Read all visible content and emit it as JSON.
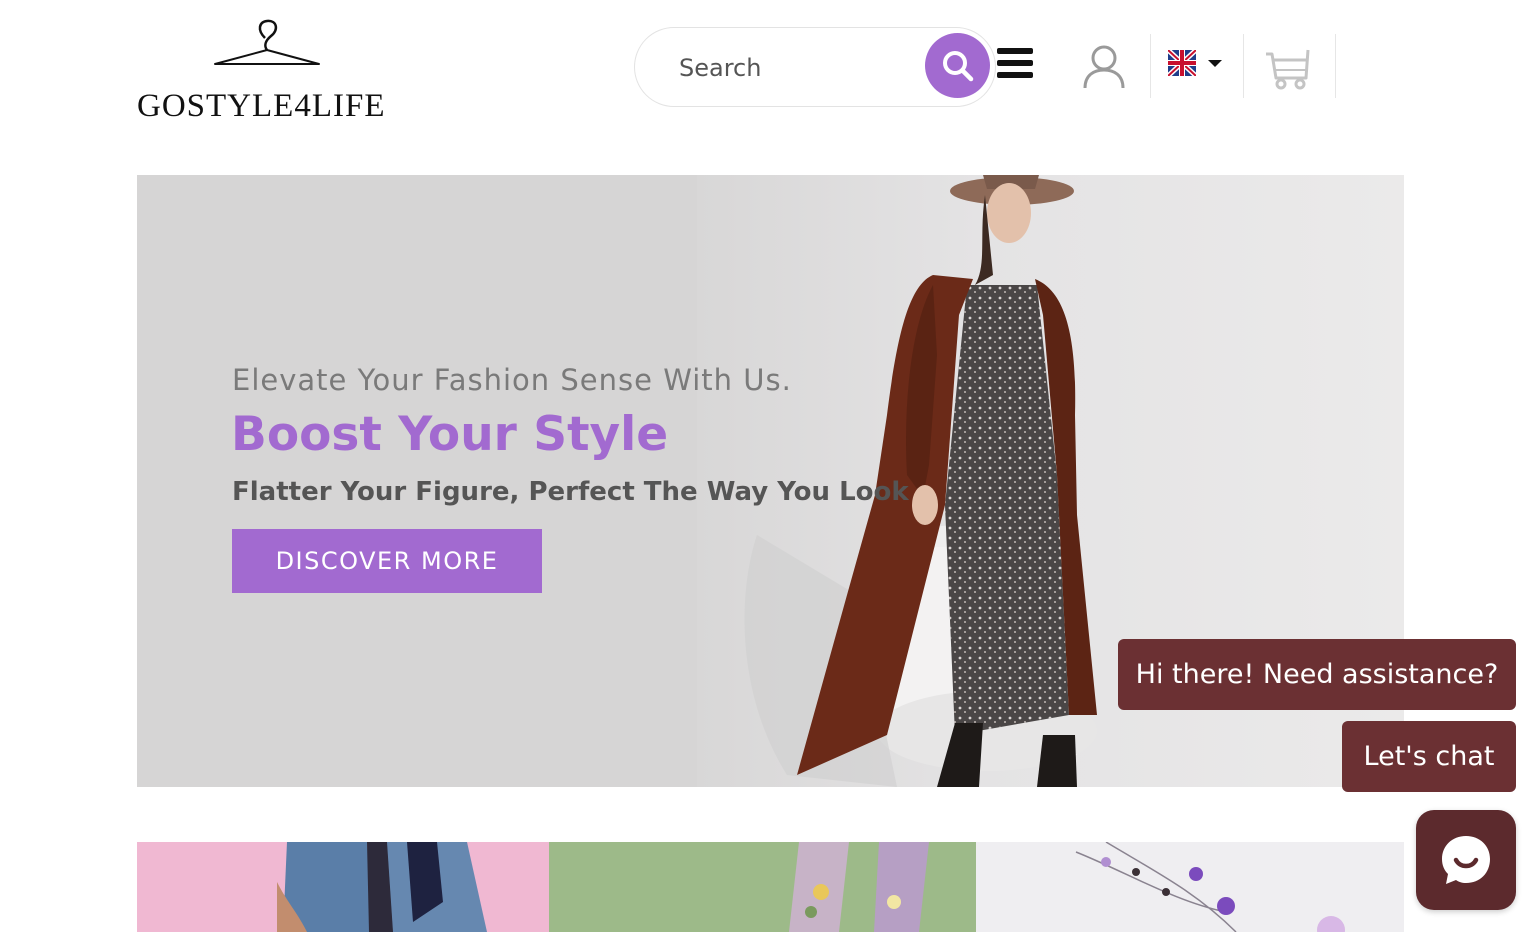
{
  "header": {
    "logo_text": "GOSTYLE4LIFE",
    "search": {
      "placeholder": "Search"
    },
    "icons": {
      "search": "search-icon",
      "menu": "hamburger-menu-icon",
      "account": "user-icon",
      "language": "uk-flag-icon",
      "cart": "cart-icon"
    }
  },
  "hero": {
    "subtitle": "Elevate Your Fashion Sense With Us.",
    "title": "Boost Your Style",
    "tagline": "Flatter Your Figure, Perfect The Way You Look",
    "cta_label": "DISCOVER MORE"
  },
  "chat": {
    "greeting": "Hi there! Need assistance?",
    "prompt": "Let's chat",
    "launcher_icon": "chat-smile-icon"
  },
  "colors": {
    "accent": "#a26ad0",
    "chat": "#6b3033",
    "hero_bg": "#d6d5d5"
  }
}
